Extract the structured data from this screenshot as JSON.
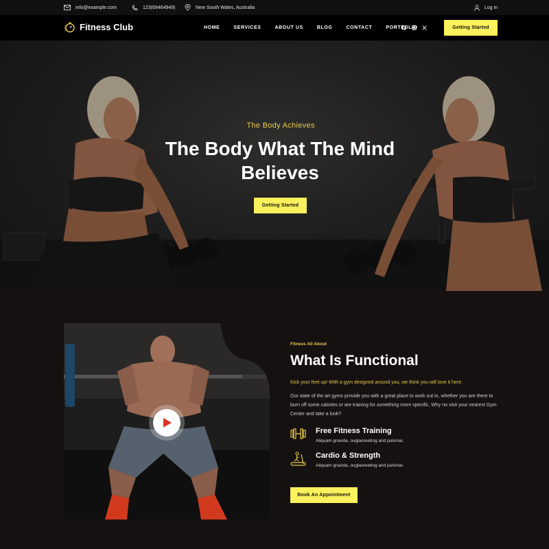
{
  "topbar": {
    "email": "info@example.com",
    "phone": "123(69464949)",
    "location": "New South Wales, Australia",
    "login_label": "Log in"
  },
  "nav": {
    "logo_text": "Fitness Club",
    "links": [
      "HOME",
      "SERVICES",
      "ABOUT US",
      "BLOG",
      "CONTACT",
      "PORTFOLIO"
    ],
    "social_icons": [
      "facebook-icon",
      "instagram-icon",
      "x-icon"
    ],
    "cta_label": "Getting Started"
  },
  "hero": {
    "subtitle": "The Body Achieves",
    "title": "The Body What The Mind Believes",
    "cta_label": "Getting Started"
  },
  "about": {
    "label": "Fitness All About",
    "title": "What Is Functional",
    "lead": "Kick your feet up! With a gym designed around you, we think you will love it here.",
    "body": "Our state of the art gyms provide you with a great place to work out in, whether you are there to burn off some calories or are training for something more specific, Why no visit your nearest Gym Center and take a look?",
    "features": [
      {
        "icon": "dumbbell-icon",
        "title": "Free Fitness Training",
        "desc": "Aliquam gravida, ouglaoreeting and pulvinar,"
      },
      {
        "icon": "treadmill-icon",
        "title": "Cardio & Strength",
        "desc": "Aliquam gravida, ouglaoreeting and pulvinar,"
      }
    ],
    "cta_label": "Book An Appointment"
  },
  "colors": {
    "accent_yellow": "#fbf15c",
    "accent_gold": "#e8c94a",
    "background_dark": "#151111",
    "nav_black": "#000000"
  }
}
